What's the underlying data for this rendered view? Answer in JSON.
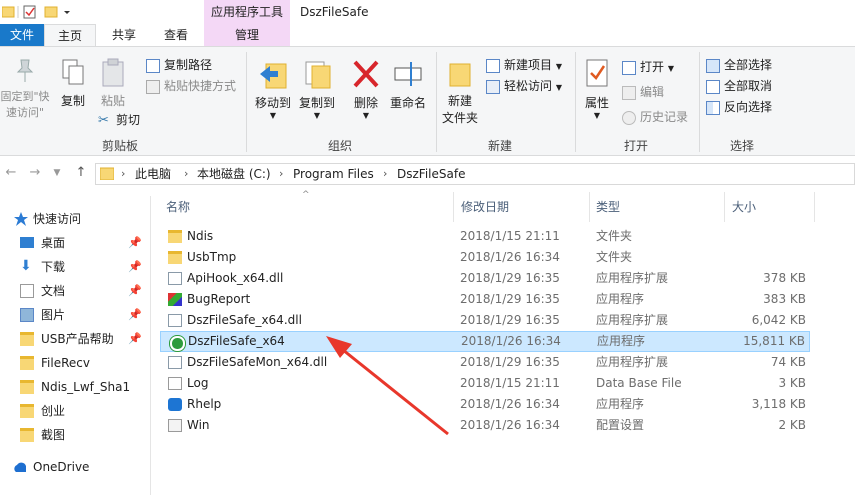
{
  "window": {
    "title": "DszFileSafe",
    "context_tab_header": "应用程序工具"
  },
  "tabs": {
    "file": "文件",
    "home": "主页",
    "share": "共享",
    "view": "查看",
    "manage": "管理"
  },
  "ribbon": {
    "clipboard": {
      "pin": "固定到\"快\n速访问\"",
      "copy": "复制",
      "paste": "粘贴",
      "copy_path": "复制路径",
      "paste_shortcut": "粘贴快捷方式",
      "cut": "剪切",
      "group": "剪贴板"
    },
    "organize": {
      "move_to": "移动到",
      "copy_to": "复制到",
      "delete": "删除",
      "rename": "重命名",
      "group": "组织"
    },
    "new": {
      "new_folder": "新建\n文件夹",
      "new_item": "新建项目",
      "easy_access": "轻松访问",
      "group": "新建"
    },
    "open": {
      "properties": "属性",
      "open": "打开",
      "edit": "编辑",
      "history": "历史记录",
      "group": "打开"
    },
    "select": {
      "select_all": "全部选择",
      "select_none": "全部取消",
      "invert": "反向选择",
      "group": "选择"
    }
  },
  "address": {
    "crumbs": [
      "此电脑",
      "本地磁盘 (C:)",
      "Program Files",
      "DszFileSafe"
    ]
  },
  "nav": {
    "quick_access": "快速访问",
    "items": [
      {
        "label": "桌面",
        "icon": "desktop-icon",
        "pinned": true
      },
      {
        "label": "下载",
        "icon": "download-icon",
        "pinned": true
      },
      {
        "label": "文档",
        "icon": "document-icon",
        "pinned": true
      },
      {
        "label": "图片",
        "icon": "picture-icon",
        "pinned": true
      },
      {
        "label": "USB产品帮助",
        "icon": "folder-icon",
        "pinned": true
      },
      {
        "label": "FileRecv",
        "icon": "folder-icon",
        "pinned": false
      },
      {
        "label": "Ndis_Lwf_Sha1",
        "icon": "folder-icon",
        "pinned": false
      },
      {
        "label": "创业",
        "icon": "folder-icon",
        "pinned": false
      },
      {
        "label": "截图",
        "icon": "folder-icon",
        "pinned": false
      }
    ],
    "onedrive": "OneDrive"
  },
  "columns": {
    "name": "名称",
    "date": "修改日期",
    "type": "类型",
    "size": "大小"
  },
  "files": [
    {
      "name": "Ndis",
      "date": "2018/1/15 21:11",
      "type": "文件夹",
      "size": "",
      "icon": "folder"
    },
    {
      "name": "UsbTmp",
      "date": "2018/1/26 16:34",
      "type": "文件夹",
      "size": "",
      "icon": "folder"
    },
    {
      "name": "ApiHook_x64.dll",
      "date": "2018/1/29 16:35",
      "type": "应用程序扩展",
      "size": "378 KB",
      "icon": "dll"
    },
    {
      "name": "BugReport",
      "date": "2018/1/29 16:35",
      "type": "应用程序",
      "size": "383 KB",
      "icon": "exe-bug"
    },
    {
      "name": "DszFileSafe_x64.dll",
      "date": "2018/1/29 16:35",
      "type": "应用程序扩展",
      "size": "6,042 KB",
      "icon": "dll"
    },
    {
      "name": "DszFileSafe_x64",
      "date": "2018/1/26 16:34",
      "type": "应用程序",
      "size": "15,811 KB",
      "icon": "exe-app",
      "selected": true
    },
    {
      "name": "DszFileSafeMon_x64.dll",
      "date": "2018/1/29 16:35",
      "type": "应用程序扩展",
      "size": "74 KB",
      "icon": "dll"
    },
    {
      "name": "Log",
      "date": "2018/1/15 21:11",
      "type": "Data Base File",
      "size": "3 KB",
      "icon": "file"
    },
    {
      "name": "Rhelp",
      "date": "2018/1/26 16:34",
      "type": "应用程序",
      "size": "3,118 KB",
      "icon": "exe-help"
    },
    {
      "name": "Win",
      "date": "2018/1/26 16:34",
      "type": "配置设置",
      "size": "2 KB",
      "icon": "ini"
    }
  ],
  "colors": {
    "file_tab": "#1979ca",
    "context_tab": "#f4d8f6",
    "selection": "#cce8ff",
    "annotation_arrow": "#e8372b"
  }
}
